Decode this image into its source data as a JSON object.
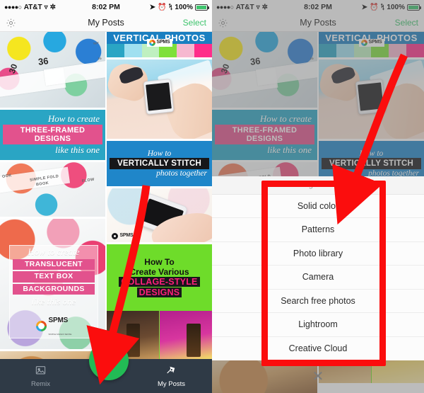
{
  "statusbar": {
    "signal_dots": "●●●●○",
    "carrier": "AT&T",
    "wifi_icon": "wifi-icon",
    "bluetooth_icon": "bluetooth-icon",
    "location_icon": "location-arrow-icon",
    "alarm_icon": "alarm-icon",
    "time": "8:02 PM",
    "battery_percent": "100%"
  },
  "navbar": {
    "settings_icon": "gear-icon",
    "title": "My Posts",
    "select_label": "Select",
    "select_color": "#3ec46d"
  },
  "grid": {
    "column_left": [
      {
        "name": "craft-supplies-top",
        "type": "photo",
        "labels": [
          "36",
          "30",
          "fo",
          "spr"
        ]
      },
      {
        "name": "three-framed-designs",
        "type": "design",
        "line1": "How to create",
        "banner": "THREE-FRAMED DESIGNS",
        "line2": "like this one",
        "bg_color": "#2aa5c4",
        "banner_color": "#e2528d"
      },
      {
        "name": "simple-fold-book-photo",
        "type": "photo",
        "labels": [
          "SIMPLE FOLD",
          "BOOK",
          "FLOW",
          "OOK"
        ]
      },
      {
        "name": "translucent-text-box-backgrounds",
        "type": "design",
        "line1": "How to create",
        "banner1": "TRANSLUCENT",
        "banner2": "TEXT BOX",
        "banner3": "BACKGROUNDS",
        "line2": "like this one",
        "logo": "SPMS",
        "logo_sub": "SIMPLE MAKES SENSE"
      },
      {
        "name": "party-drinks-photo",
        "type": "photo",
        "labels": []
      }
    ],
    "column_right": [
      {
        "name": "vertical-photos-strip",
        "type": "design",
        "title": "VERTICAL PHOTOS",
        "logo": "SPMS",
        "swatches": [
          "#2aa5c4",
          "#9fe0f0",
          "#bff0c0",
          "#7ee03a",
          "#f6b8d0",
          "#ff2d8a"
        ]
      },
      {
        "name": "beach-phone-photo",
        "type": "photo",
        "labels": []
      },
      {
        "name": "vertically-stitch-photos",
        "type": "design",
        "line1": "How to",
        "banner": "VERTICALLY STITCH",
        "line2": "photos together",
        "bg_color": "#1f86c9"
      },
      {
        "name": "white-phone-photo",
        "type": "photo",
        "logo": "SPMS"
      },
      {
        "name": "collage-style-designs",
        "type": "design",
        "line1": "How To",
        "line2": "Create Various",
        "banner1": "COLLAGE-STYLE",
        "banner2": "DESIGNS",
        "bg_color": "#6edc2a",
        "banner_text_color": "#ff1f7a"
      }
    ]
  },
  "tabbar": {
    "items": [
      {
        "name": "tab-remix",
        "label": "Remix",
        "icon": "photo-stack-icon",
        "active": false
      },
      {
        "name": "tab-my-posts",
        "label": "My Posts",
        "icon": "pin-icon",
        "active": true
      }
    ],
    "fab": {
      "name": "create-button",
      "icon": "plus-icon",
      "color": "#22bb55"
    },
    "bg_color": "#2f3a46"
  },
  "action_sheet": {
    "header": "Create designs and collages",
    "items": [
      "Solid color",
      "Patterns",
      "Photo library",
      "Camera",
      "Search free photos",
      "Lightroom",
      "Creative Cloud"
    ],
    "close_icon": "close-x-icon"
  },
  "annotations": {
    "highlight_color": "#fb0d0d",
    "arrow_left": {
      "name": "arrow-to-create-button",
      "from": "205,265",
      "to": "152,500"
    },
    "arrow_right": {
      "name": "arrow-to-action-sheet",
      "from": "570,85",
      "to": "495,275"
    },
    "redbox": {
      "name": "action-sheet-highlight-box"
    }
  }
}
